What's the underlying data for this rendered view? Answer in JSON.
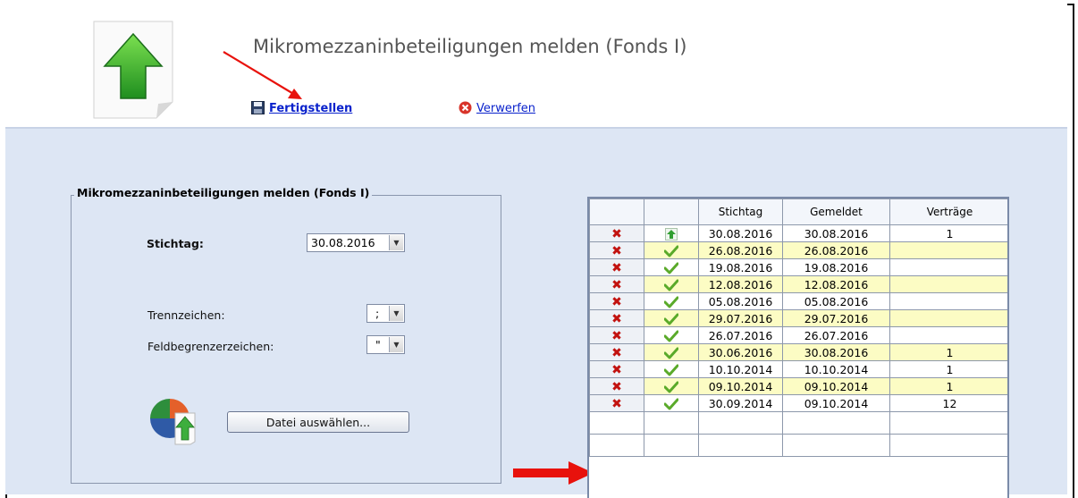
{
  "header": {
    "title": "Mikromezzaninbeteiligungen melden (Fonds I)",
    "actions": {
      "finish_label": "Fertigstellen",
      "discard_label": "Verwerfen"
    }
  },
  "form": {
    "legend": "Mikromezzaninbeteiligungen melden (Fonds I)",
    "stichtag_label": "Stichtag:",
    "stichtag_value": "30.08.2016",
    "trennzeichen_label": "Trennzeichen:",
    "trennzeichen_value": ";",
    "feldbegrenzer_label": "Feldbegrenzerzeichen:",
    "feldbegrenzer_value": "\"",
    "file_button_label": "Datei auswählen..."
  },
  "table": {
    "columns": [
      "",
      "",
      "Stichtag",
      "Gemeldet",
      "Verträge"
    ],
    "rows": [
      {
        "status": "upload",
        "stichtag": "30.08.2016",
        "gemeldet": "30.08.2016",
        "vertraege": "1"
      },
      {
        "status": "ok",
        "stichtag": "26.08.2016",
        "gemeldet": "26.08.2016",
        "vertraege": ""
      },
      {
        "status": "ok",
        "stichtag": "19.08.2016",
        "gemeldet": "19.08.2016",
        "vertraege": ""
      },
      {
        "status": "ok",
        "stichtag": "12.08.2016",
        "gemeldet": "12.08.2016",
        "vertraege": ""
      },
      {
        "status": "ok",
        "stichtag": "05.08.2016",
        "gemeldet": "05.08.2016",
        "vertraege": ""
      },
      {
        "status": "ok",
        "stichtag": "29.07.2016",
        "gemeldet": "29.07.2016",
        "vertraege": ""
      },
      {
        "status": "ok",
        "stichtag": "26.07.2016",
        "gemeldet": "26.07.2016",
        "vertraege": ""
      },
      {
        "status": "ok",
        "stichtag": "30.06.2016",
        "gemeldet": "30.08.2016",
        "vertraege": "1"
      },
      {
        "status": "ok",
        "stichtag": "10.10.2014",
        "gemeldet": "10.10.2014",
        "vertraege": "1"
      },
      {
        "status": "ok",
        "stichtag": "09.10.2014",
        "gemeldet": "09.10.2014",
        "vertraege": "1"
      },
      {
        "status": "ok",
        "stichtag": "30.09.2014",
        "gemeldet": "09.10.2014",
        "vertraege": "12"
      }
    ]
  },
  "colors": {
    "content_bg": "#dde6f4",
    "row_highlight": "#fcfcc4",
    "link": "#0a22cc",
    "annotation_arrow": "#e8120c"
  },
  "icons": {
    "page_icon": "upload-document-icon",
    "finish_icon": "floppy-disk-icon",
    "discard_icon": "red-x-circle-icon",
    "delete_icon": "red-x-icon",
    "ok_icon": "green-check-icon",
    "upload_icon": "green-up-arrow-icon"
  }
}
